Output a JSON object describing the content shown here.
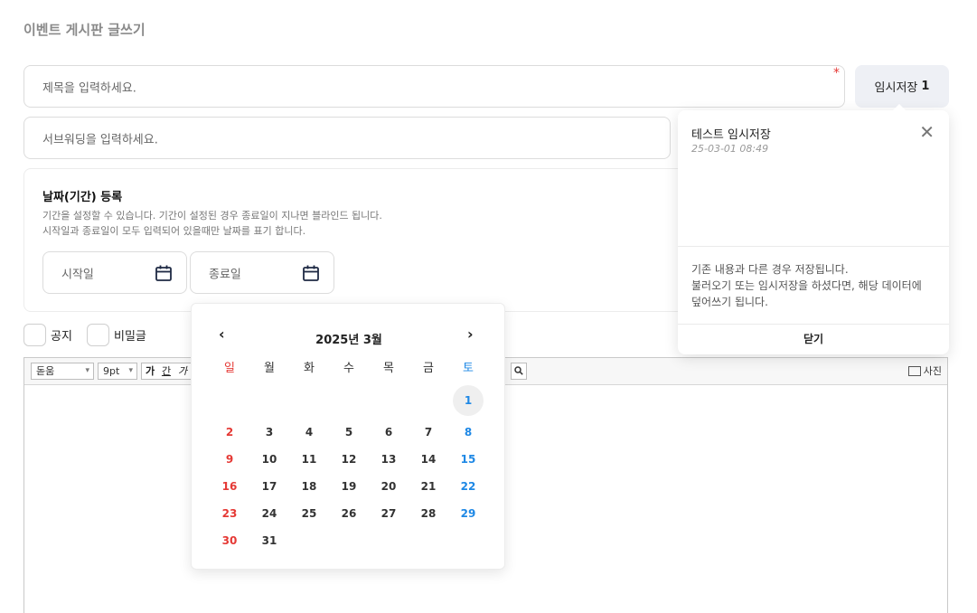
{
  "page": {
    "title": "이벤트 게시판 글쓰기"
  },
  "form": {
    "title_placeholder": "제목을 입력하세요.",
    "required_mark": "*",
    "subtitle_placeholder": "서브워딩을 입력하세요.",
    "temp_save": {
      "label": "임시저장",
      "count": "1"
    }
  },
  "date_section": {
    "heading": "날짜(기간) 등록",
    "desc_line1": "기간을 설정할 수 있습니다. 기간이 설정된 경우 종료일이 지나면 블라인드 됩니다.",
    "desc_line2": "시작일과 종료일이 모두 입력되어 있을때만 날짜를 표기 합니다.",
    "start_placeholder": "시작일",
    "end_placeholder": "종료일"
  },
  "options": {
    "notice_label": "공지",
    "secret_label": "비밀글"
  },
  "editor_toolbar": {
    "font": "돋움",
    "size": "9pt",
    "bold": "가",
    "underline": "간",
    "italic": "가",
    "search_icon": "magnifier-icon",
    "photo_label": "사진"
  },
  "calendar": {
    "prev": "‹",
    "next": "›",
    "month_label": "2025년 3월",
    "weekdays": [
      "일",
      "월",
      "화",
      "수",
      "목",
      "금",
      "토"
    ],
    "weeks": [
      [
        "",
        "",
        "",
        "",
        "",
        "",
        "1"
      ],
      [
        "2",
        "3",
        "4",
        "5",
        "6",
        "7",
        "8"
      ],
      [
        "9",
        "10",
        "11",
        "12",
        "13",
        "14",
        "15"
      ],
      [
        "16",
        "17",
        "18",
        "19",
        "20",
        "21",
        "22"
      ],
      [
        "23",
        "24",
        "25",
        "26",
        "27",
        "28",
        "29"
      ],
      [
        "30",
        "31",
        "",
        "",
        "",
        "",
        ""
      ]
    ],
    "today": "1",
    "colors": {
      "sunday": "#e53935",
      "saturday": "#1e88e5"
    }
  },
  "temp_popup": {
    "item_title": "테스트 임시저장",
    "item_time": "25-03-01 08:49",
    "close_icon": "close-icon",
    "message_line1": "기존 내용과 다른 경우 저장됩니다.",
    "message_line2": "불러오기 또는 임시저장을 하셨다면, 해당 데이터에",
    "message_line3": "덮어쓰기 됩니다.",
    "confirm_label": "닫기"
  }
}
